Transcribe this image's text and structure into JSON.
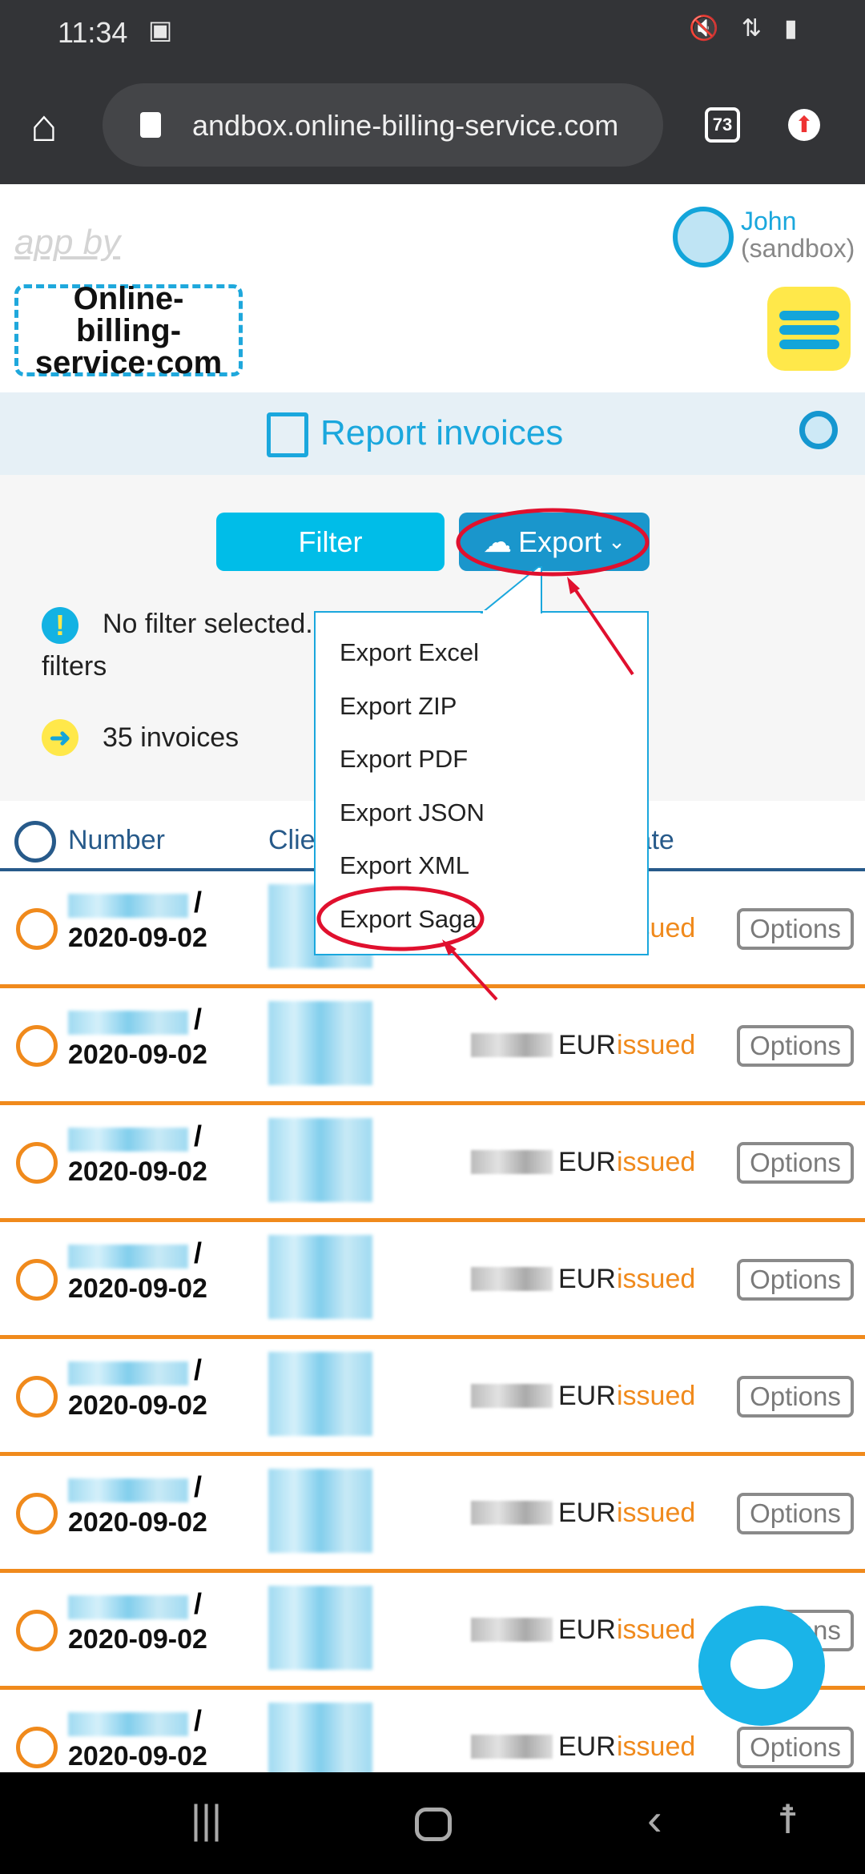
{
  "status_bar": {
    "time": "11:34"
  },
  "browser": {
    "url": "andbox.online-billing-service.com",
    "tab_count": "73"
  },
  "header": {
    "app_by": "app by",
    "logo_text": "Online-billing-service.com",
    "user_name": "John",
    "user_env": "(sandbox)"
  },
  "title": "Report invoices",
  "toolbar": {
    "filter_label": "Filter",
    "export_label": "Export"
  },
  "info": {
    "filter_msg": "No filter selected. Select one or more",
    "filter_msg_end": "filters",
    "count": "35 invoices"
  },
  "export_menu": [
    "Export Excel",
    "Export ZIP",
    "Export PDF",
    "Export JSON",
    "Export XML",
    "Export Saga"
  ],
  "table": {
    "headers": [
      "Number",
      "Client",
      "Date"
    ],
    "rows": [
      {
        "date": "2020-09-02",
        "currency": "",
        "status": "issued",
        "options": "Options"
      },
      {
        "date": "2020-09-02",
        "currency": "EUR",
        "status": "issued",
        "options": "Options"
      },
      {
        "date": "2020-09-02",
        "currency": "EUR",
        "status": "issued",
        "options": "Options"
      },
      {
        "date": "2020-09-02",
        "currency": "EUR",
        "status": "issued",
        "options": "Options"
      },
      {
        "date": "2020-09-02",
        "currency": "EUR",
        "status": "issued",
        "options": "Options"
      },
      {
        "date": "2020-09-02",
        "currency": "EUR",
        "status": "issued",
        "options": "Options"
      },
      {
        "date": "2020-09-02",
        "currency": "EUR",
        "status": "issued",
        "options": "Options"
      },
      {
        "date": "2020-09-02",
        "currency": "EUR",
        "status": "issued",
        "options": "Options"
      }
    ]
  },
  "colors": {
    "accent": "#00bde8",
    "export_bg": "#1a96cc",
    "status_issued": "#f08a1c",
    "annotation": "#e0102e"
  }
}
